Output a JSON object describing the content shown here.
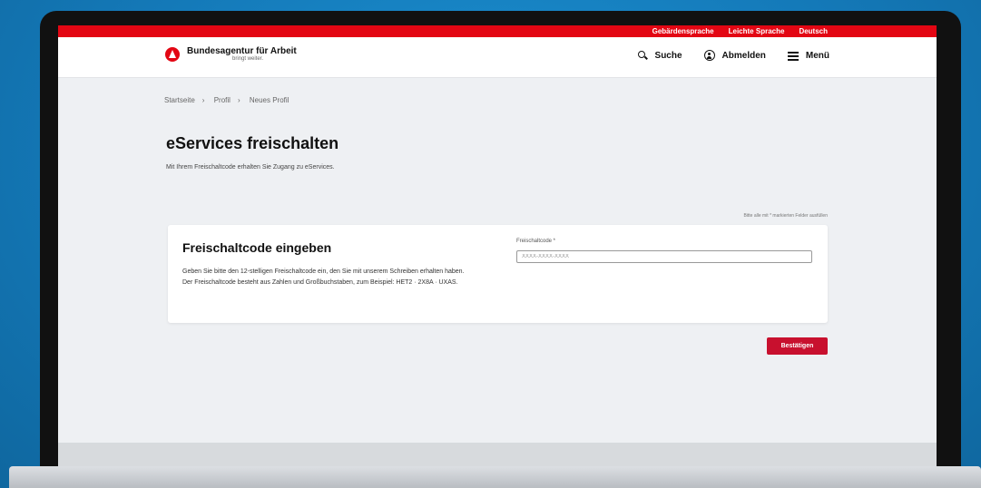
{
  "topbar": {
    "items": [
      "Gebärdensprache",
      "Leichte Sprache",
      "Deutsch"
    ]
  },
  "header": {
    "brand": "Bundesagentur für Arbeit",
    "claim": "bringt weiter."
  },
  "nav": {
    "search": "Suche",
    "logout": "Abmelden",
    "menu": "Menü"
  },
  "breadcrumb": {
    "items": [
      "Startseite",
      "Profil",
      "Neues Profil"
    ]
  },
  "page": {
    "title": "eServices freischalten",
    "intro": "Mit Ihrem Freischaltcode erhalten Sie Zugang zu eServices.",
    "required_note": "Bitte alle mit * markierten Felder ausfüllen"
  },
  "card": {
    "title": "Freischaltcode eingeben",
    "text": "Geben Sie bitte den 12-stelligen Freischaltcode ein, den Sie mit unserem Schreiben erhalten haben. Der Freischaltcode besteht aus Zahlen und Großbuchstaben, zum Beispiel: HET2 · 2X8A · UXAS.",
    "field_label": "Freischaltcode *",
    "field_placeholder": "XXXX-XXXX-XXXX",
    "submit_label": "Bestätigen"
  },
  "colors": {
    "brand_red": "#e30613",
    "button_red": "#c8102e",
    "background": "#eef0f3"
  }
}
